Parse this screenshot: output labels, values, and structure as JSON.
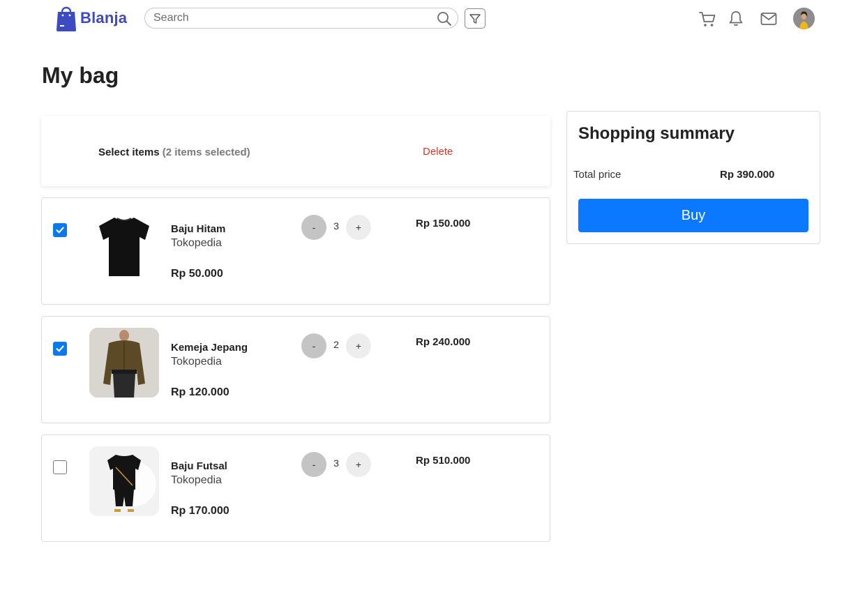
{
  "brand": {
    "name": "Blanja",
    "color": "#3d4bc2"
  },
  "search": {
    "placeholder": "Search"
  },
  "page": {
    "title": "My bag"
  },
  "selection": {
    "label": "Select items",
    "count_text": "(2 items selected)",
    "delete_label": "Delete"
  },
  "items": [
    {
      "name": "Baju Hitam",
      "store": "Tokopedia",
      "price": "Rp 50.000",
      "quantity": "3",
      "total": "Rp 150.000",
      "checked": true,
      "minus_label": "-",
      "plus_label": "+"
    },
    {
      "name": "Kemeja Jepang",
      "store": "Tokopedia",
      "price": "Rp 120.000",
      "quantity": "2",
      "total": "Rp 240.000",
      "checked": true,
      "minus_label": "-",
      "plus_label": "+"
    },
    {
      "name": "Baju Futsal",
      "store": "Tokopedia",
      "price": "Rp 170.000",
      "quantity": "3",
      "total": "Rp 510.000",
      "checked": false,
      "minus_label": "-",
      "plus_label": "+"
    }
  ],
  "summary": {
    "title": "Shopping summary",
    "total_label": "Total price",
    "total_value": "Rp 390.000",
    "buy_label": "Buy"
  },
  "icons": {
    "logo": "shopping-bag-icon",
    "search": "search-icon",
    "filter": "filter-icon",
    "cart": "cart-icon",
    "notifications": "bell-icon",
    "messages": "mail-icon"
  },
  "colors": {
    "accent": "#0b79ff",
    "delete": "#d23b2a",
    "checkbox": "#0b79ec"
  }
}
